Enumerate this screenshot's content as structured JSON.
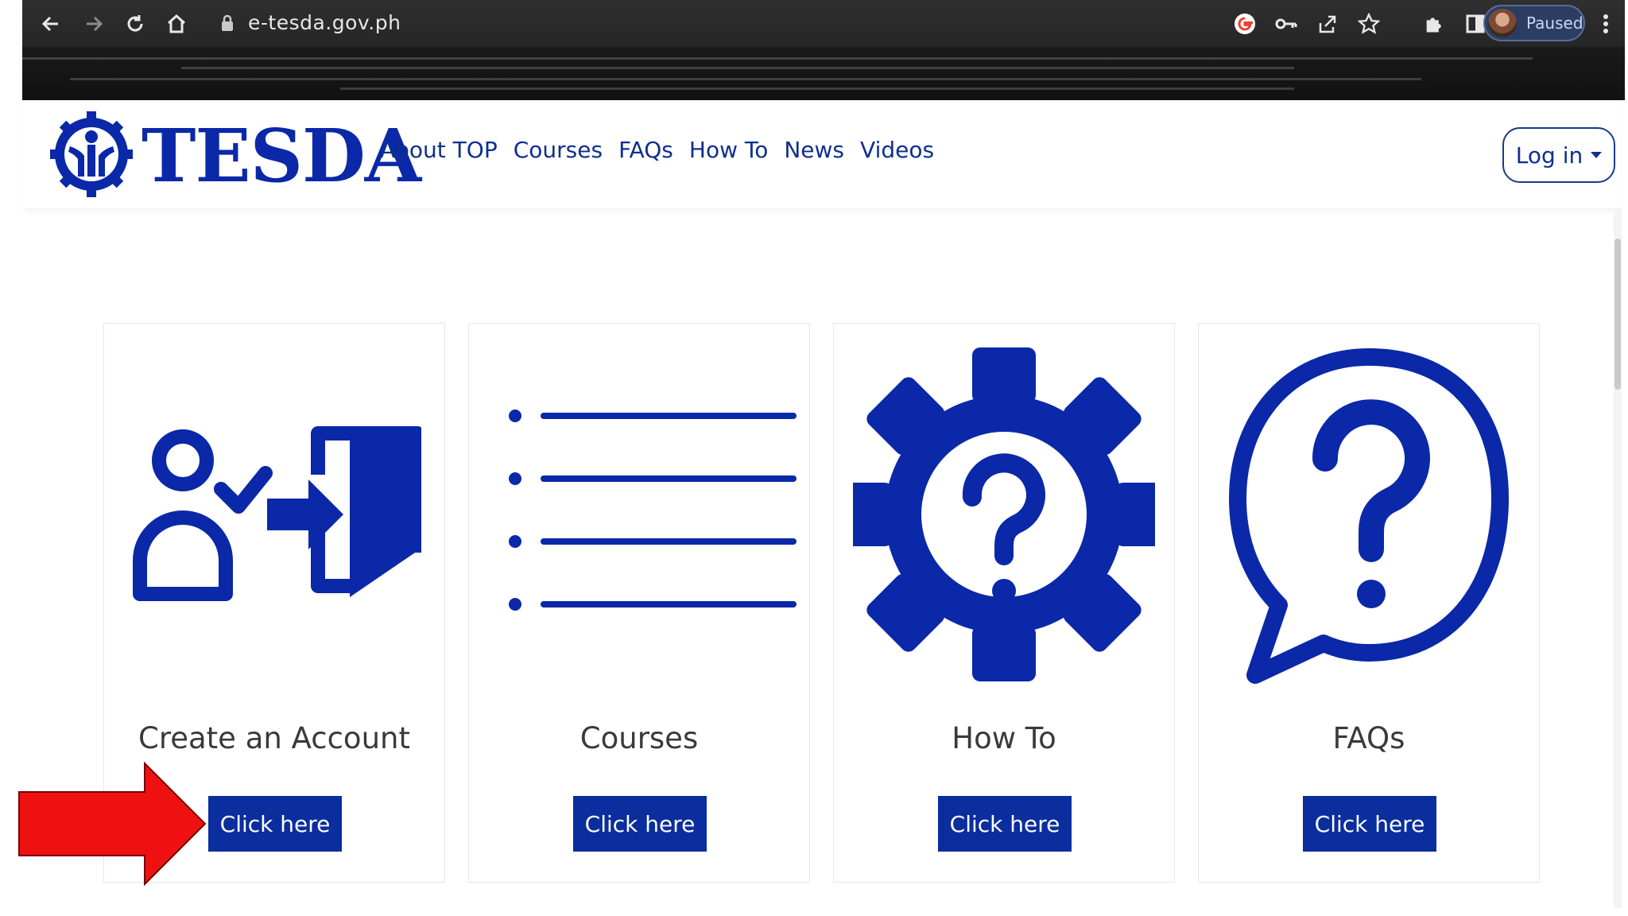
{
  "browser": {
    "url": "e-tesda.gov.ph",
    "profile_status": "Paused",
    "icons": [
      "back-arrow-icon",
      "forward-arrow-icon",
      "reload-icon",
      "home-icon",
      "lock-icon",
      "google-icon",
      "key-icon",
      "share-icon",
      "star-icon",
      "puzzle-icon",
      "sidepanel-icon",
      "kebab-menu-icon"
    ]
  },
  "header": {
    "logo_text": "TESDA",
    "nav": [
      "About TOP",
      "Courses",
      "FAQs",
      "How To",
      "News",
      "Videos"
    ],
    "login_label": "Log in"
  },
  "cards": [
    {
      "title": "Create an Account",
      "button": "Click here",
      "icon": "create-account-icon"
    },
    {
      "title": "Courses",
      "button": "Click here",
      "icon": "list-icon"
    },
    {
      "title": "How To",
      "button": "Click here",
      "icon": "gear-question-icon"
    },
    {
      "title": "FAQs",
      "button": "Click here",
      "icon": "speech-question-icon"
    }
  ],
  "colors": {
    "brand": "#0a28a8",
    "button": "#0a2e9e",
    "annotation": "#ee1111"
  }
}
